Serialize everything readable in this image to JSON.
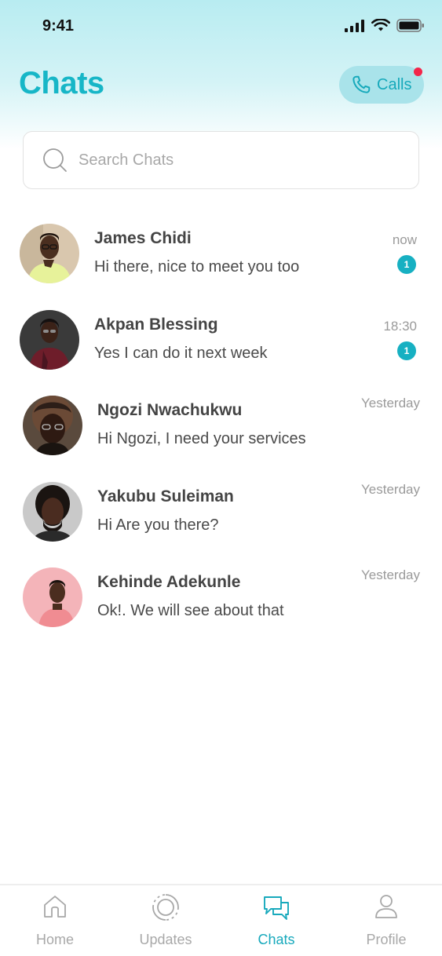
{
  "status_bar": {
    "time": "9:41"
  },
  "header": {
    "title": "Chats",
    "calls_label": "Calls"
  },
  "search": {
    "placeholder": "Search Chats"
  },
  "chats": [
    {
      "name": "James Chidi",
      "message": "Hi there, nice to meet you too",
      "time": "now",
      "unread": "1"
    },
    {
      "name": "Akpan Blessing",
      "message": "Yes I can do it next week",
      "time": "18:30",
      "unread": "1"
    },
    {
      "name": "Ngozi Nwachukwu",
      "message": "Hi Ngozi, I need your services",
      "time": "Yesterday",
      "unread": ""
    },
    {
      "name": "Yakubu Suleiman",
      "message": "Hi Are you there?",
      "time": "Yesterday",
      "unread": ""
    },
    {
      "name": "Kehinde Adekunle",
      "message": "Ok!. We will see about that",
      "time": "Yesterday",
      "unread": ""
    }
  ],
  "tabs": [
    {
      "label": "Home",
      "icon": "home-icon",
      "active": false
    },
    {
      "label": "Updates",
      "icon": "updates-icon",
      "active": false
    },
    {
      "label": "Chats",
      "icon": "chats-icon",
      "active": true
    },
    {
      "label": "Profile",
      "icon": "profile-icon",
      "active": false
    }
  ],
  "colors": {
    "accent": "#17b6c7",
    "badge": "#17b0c2",
    "notification_dot": "#f3264a"
  }
}
